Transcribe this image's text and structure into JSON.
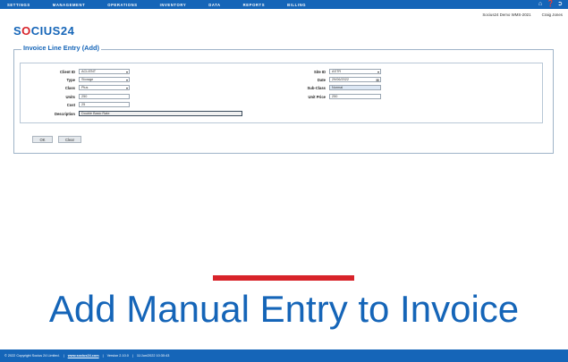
{
  "nav": {
    "items": [
      "SETTINGS",
      "MANAGEMENT",
      "OPERATIONS",
      "INVENTORY",
      "DATA",
      "REPORTS",
      "BILLING"
    ],
    "icons": [
      "home-icon",
      "help-icon",
      "logout-icon"
    ]
  },
  "header": {
    "environment": "Socius24 Demo WMS-2021",
    "user": "Craig Jones"
  },
  "logo": {
    "part1": "S",
    "part2": "O",
    "part3": "CIUS24"
  },
  "form": {
    "legend": "Invoice Line Entry (Add)",
    "client_id_label": "Client ID",
    "client_id_value": "ACLIENT",
    "type_label": "Type",
    "type_value": "Storage",
    "class_label": "Class",
    "class_value": "Plus",
    "units_label": "Units",
    "units_value": "250",
    "cost_label": "Cost",
    "cost_value": "25",
    "description_label": "Description",
    "description_value": "Double Basic Rate",
    "site_id_label": "Site ID",
    "site_id_value": "ASTR",
    "date_label": "Date",
    "date_value": "29/06/2022",
    "subclass_label": "Sub-Class",
    "subclass_value": "Normal",
    "unit_price_label": "Unit Price",
    "unit_price_value": "250",
    "ok_label": "OK",
    "clear_label": "Clear"
  },
  "headline": "Add Manual Entry to Invoice",
  "footer": {
    "copyright": "© 2022 Copyright Socius 24 Limited.",
    "sep": "|",
    "website": "www.socius24.com",
    "version": "Version 2.10.0",
    "timestamp": "11/Jun/2022 10:30:43"
  },
  "colors": {
    "brand": "#1565b8",
    "accent": "#d8232a"
  }
}
